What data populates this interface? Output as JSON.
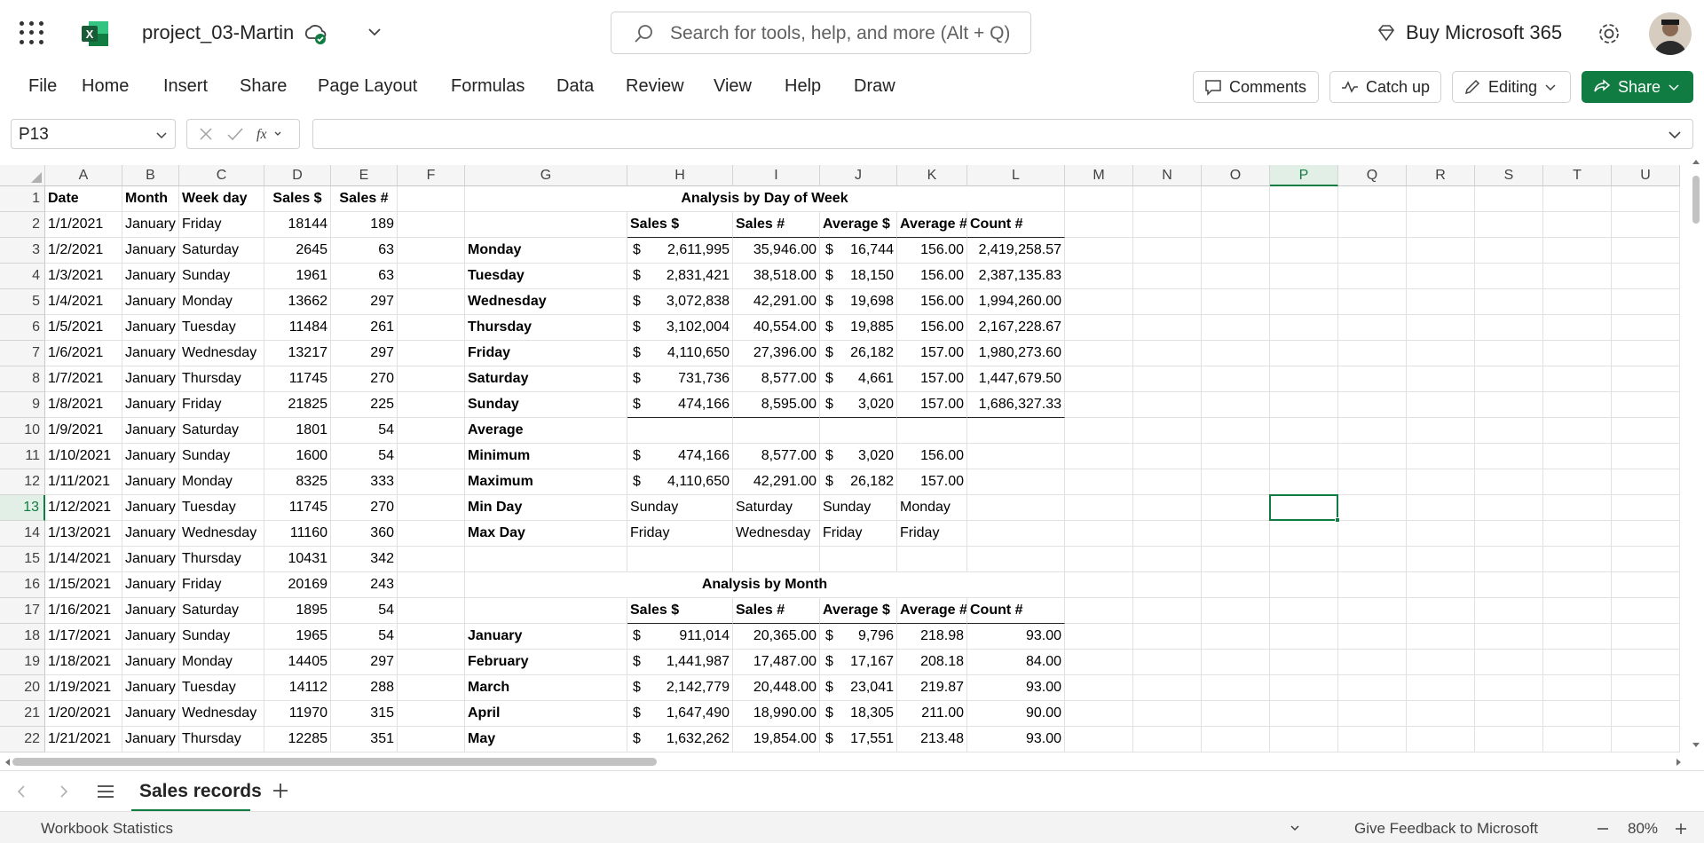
{
  "header": {
    "file_name": "project_03-Martin",
    "search_placeholder": "Search for tools, help, and more (Alt + Q)",
    "buy_label": "Buy Microsoft 365"
  },
  "ribbon": {
    "tabs": [
      "File",
      "Home",
      "Insert",
      "Share",
      "Page Layout",
      "Formulas",
      "Data",
      "Review",
      "View",
      "Help",
      "Draw"
    ],
    "comments": "Comments",
    "catch_up": "Catch up",
    "editing": "Editing",
    "share": "Share"
  },
  "formula_bar": {
    "name_box": "P13",
    "formula": ""
  },
  "columns": [
    "A",
    "B",
    "C",
    "D",
    "E",
    "F",
    "G",
    "H",
    "I",
    "J",
    "K",
    "L",
    "M",
    "N",
    "O",
    "P",
    "Q",
    "R",
    "S",
    "T",
    "U"
  ],
  "rows": [
    "1",
    "2",
    "3",
    "4",
    "5",
    "6",
    "7",
    "8",
    "9",
    "10",
    "11",
    "12",
    "13",
    "14",
    "15",
    "16",
    "17",
    "18",
    "19",
    "20",
    "21",
    "22"
  ],
  "selected_cell": "P13",
  "data_headers": [
    "Date",
    "Month",
    "Week day",
    "Sales $",
    "Sales #"
  ],
  "data_rows": [
    [
      "1/1/2021",
      "January",
      "Friday",
      "18144",
      "189"
    ],
    [
      "1/2/2021",
      "January",
      "Saturday",
      "2645",
      "63"
    ],
    [
      "1/3/2021",
      "January",
      "Sunday",
      "1961",
      "63"
    ],
    [
      "1/4/2021",
      "January",
      "Monday",
      "13662",
      "297"
    ],
    [
      "1/5/2021",
      "January",
      "Tuesday",
      "11484",
      "261"
    ],
    [
      "1/6/2021",
      "January",
      "Wednesday",
      "13217",
      "297"
    ],
    [
      "1/7/2021",
      "January",
      "Thursday",
      "11745",
      "270"
    ],
    [
      "1/8/2021",
      "January",
      "Friday",
      "21825",
      "225"
    ],
    [
      "1/9/2021",
      "January",
      "Saturday",
      "1801",
      "54"
    ],
    [
      "1/10/2021",
      "January",
      "Sunday",
      "1600",
      "54"
    ],
    [
      "1/11/2021",
      "January",
      "Monday",
      "8325",
      "333"
    ],
    [
      "1/12/2021",
      "January",
      "Tuesday",
      "11745",
      "270"
    ],
    [
      "1/13/2021",
      "January",
      "Wednesday",
      "11160",
      "360"
    ],
    [
      "1/14/2021",
      "January",
      "Thursday",
      "10431",
      "342"
    ],
    [
      "1/15/2021",
      "January",
      "Friday",
      "20169",
      "243"
    ],
    [
      "1/16/2021",
      "January",
      "Saturday",
      "1895",
      "54"
    ],
    [
      "1/17/2021",
      "January",
      "Sunday",
      "1965",
      "54"
    ],
    [
      "1/18/2021",
      "January",
      "Monday",
      "14405",
      "297"
    ],
    [
      "1/19/2021",
      "January",
      "Tuesday",
      "14112",
      "288"
    ],
    [
      "1/20/2021",
      "January",
      "Wednesday",
      "11970",
      "315"
    ],
    [
      "1/21/2021",
      "January",
      "Thursday",
      "12285",
      "351"
    ]
  ],
  "dow_analysis": {
    "title": "Analysis by Day of Week",
    "headers": [
      "Sales $",
      "Sales #",
      "Average $",
      "Average #",
      "Count #"
    ],
    "currency": "$",
    "rows": [
      [
        "Monday",
        "2,611,995",
        "35,946.00",
        "16,744",
        "156.00",
        "2,419,258.57"
      ],
      [
        "Tuesday",
        "2,831,421",
        "38,518.00",
        "18,150",
        "156.00",
        "2,387,135.83"
      ],
      [
        "Wednesday",
        "3,072,838",
        "42,291.00",
        "19,698",
        "156.00",
        "1,994,260.00"
      ],
      [
        "Thursday",
        "3,102,004",
        "40,554.00",
        "19,885",
        "156.00",
        "2,167,228.67"
      ],
      [
        "Friday",
        "4,110,650",
        "27,396.00",
        "26,182",
        "157.00",
        "1,980,273.60"
      ],
      [
        "Saturday",
        "731,736",
        "8,577.00",
        "4,661",
        "157.00",
        "1,447,679.50"
      ],
      [
        "Sunday",
        "474,166",
        "8,595.00",
        "3,020",
        "157.00",
        "1,686,327.33"
      ]
    ],
    "average_label": "Average",
    "minimum": [
      "Minimum",
      "474,166",
      "8,577.00",
      "3,020",
      "156.00"
    ],
    "maximum": [
      "Maximum",
      "4,110,650",
      "42,291.00",
      "26,182",
      "157.00"
    ],
    "min_day": [
      "Min Day",
      "Sunday",
      "Saturday",
      "Sunday",
      "Monday"
    ],
    "max_day": [
      "Max Day",
      "Friday",
      "Wednesday",
      "Friday",
      "Friday"
    ]
  },
  "month_analysis": {
    "title": "Analysis by Month",
    "headers": [
      "Sales $",
      "Sales #",
      "Average $",
      "Average #",
      "Count #"
    ],
    "rows": [
      [
        "January",
        "911,014",
        "20,365.00",
        "9,796",
        "218.98",
        "93.00"
      ],
      [
        "February",
        "1,441,987",
        "17,487.00",
        "17,167",
        "208.18",
        "84.00"
      ],
      [
        "March",
        "2,142,779",
        "20,448.00",
        "23,041",
        "219.87",
        "93.00"
      ],
      [
        "April",
        "1,647,490",
        "18,990.00",
        "18,305",
        "211.00",
        "90.00"
      ],
      [
        "May",
        "1,632,262",
        "19,854.00",
        "17,551",
        "213.48",
        "93.00"
      ]
    ]
  },
  "sheet_tabs": {
    "active": "Sales records"
  },
  "status": {
    "left": "Workbook Statistics",
    "feedback": "Give Feedback to Microsoft",
    "zoom": "80%"
  },
  "colors": {
    "accent": "#107c41",
    "excel_green": "#107c41"
  }
}
